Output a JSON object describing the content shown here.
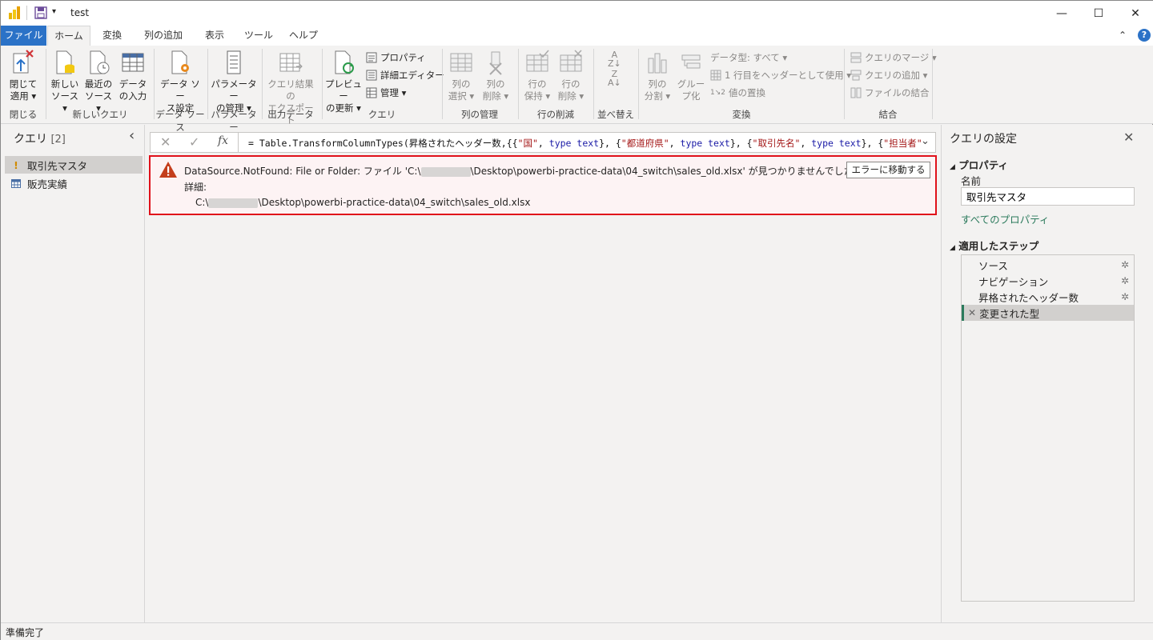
{
  "window": {
    "title": "test",
    "minimize": "—",
    "maximize": "☐",
    "close": "✕"
  },
  "tabs": [
    "ファイル",
    "ホーム",
    "変換",
    "列の追加",
    "表示",
    "ツール",
    "ヘルプ"
  ],
  "ribbon": {
    "close_apply": {
      "line1": "閉じて",
      "line2": "適用 ▾",
      "group": "閉じる"
    },
    "new_source": {
      "line1": "新しい",
      "line2": "ソース ▾"
    },
    "recent_source": {
      "line1": "最近の",
      "line2": "ソース ▾"
    },
    "enter_data": {
      "line1": "データ",
      "line2": "の入力"
    },
    "new_query_group": "新しいクエリ",
    "ds_settings": {
      "line1": "データ ソー",
      "line2": "ス設定",
      "group": "データ ソース"
    },
    "params": {
      "line1": "パラメーター",
      "line2": "の管理 ▾",
      "group": "パラメーター"
    },
    "export": {
      "line1": "クエリ結果の",
      "line2": "エクスポート",
      "group": "出力データ"
    },
    "refresh": {
      "line1": "プレビュー",
      "line2": "の更新 ▾"
    },
    "properties": "プロパティ",
    "advanced_editor": "詳細エディター",
    "manage": "管理 ▾",
    "query_group": "クエリ",
    "choose_cols": {
      "line1": "列の",
      "line2": "選択 ▾"
    },
    "remove_cols": {
      "line1": "列の",
      "line2": "削除 ▾"
    },
    "manage_cols_group": "列の管理",
    "keep_rows": {
      "line1": "行の",
      "line2": "保持 ▾"
    },
    "remove_rows": {
      "line1": "行の",
      "line2": "削除 ▾"
    },
    "reduce_rows_group": "行の削減",
    "sort_group": "並べ替え",
    "split_col": {
      "line1": "列の",
      "line2": "分割 ▾"
    },
    "group_by": {
      "line1": "グルー",
      "line2": "プ化"
    },
    "data_type": "データ型: すべて ▾",
    "first_row_header": "1 行目をヘッダーとして使用 ▾",
    "replace_values": "値の置換",
    "transform_group": "変換",
    "merge_queries": "クエリのマージ ▾",
    "append_queries": "クエリの追加 ▾",
    "combine_files": "ファイルの結合",
    "combine_group": "結合"
  },
  "left_pane": {
    "title": "クエリ",
    "count": "[2]",
    "collapse_glyph": "‹",
    "queries": [
      {
        "name": "取引先マスタ",
        "status": "!"
      },
      {
        "name": "販売実績"
      }
    ]
  },
  "formula_bar": {
    "fx": "fx",
    "prefix": "= Table.TransformColumnTypes(昇格されたヘッダー数,{{",
    "s1": "\"国\"",
    "s2": "\"都道府県\"",
    "s3": "\"取引先名\"",
    "s4": "\"担当者\"",
    "type_text": "type text",
    "sep1": "}, {",
    "sep2": ", "
  },
  "error": {
    "prefix": "DataSource.NotFound: File or Folder: ファイル 'C:\\",
    "suffix": "\\Desktop\\powerbi-practice-data\\04_switch\\sales_old.xlsx' が見つかりませんでした。",
    "detail_label": "詳細:",
    "detail_prefix": "C:\\",
    "detail_suffix": "\\Desktop\\powerbi-practice-data\\04_switch\\sales_old.xlsx",
    "goto_button": "エラーに移動する"
  },
  "right_pane": {
    "title": "クエリの設定",
    "properties_header": "プロパティ",
    "name_label": "名前",
    "name_value": "取引先マスタ",
    "all_properties_link": "すべてのプロパティ",
    "applied_steps_header": "適用したステップ",
    "steps": [
      "ソース",
      "ナビゲーション",
      "昇格されたヘッダー数",
      "変更された型"
    ]
  },
  "status_bar": {
    "text": "準備完了"
  },
  "colors": {
    "file_tab": "#2b72c7",
    "error_border": "#e0101a",
    "error_icon": "#c43e1c",
    "link": "#2b7a5c"
  }
}
